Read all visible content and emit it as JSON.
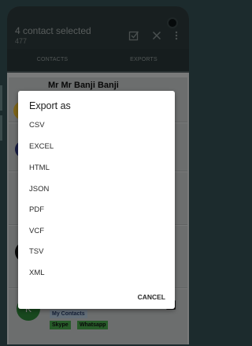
{
  "appbar": {
    "title": "4 contact selected",
    "subtitle": "477"
  },
  "tabs": [
    {
      "label": "CONTACTS"
    },
    {
      "label": "EXPORTS"
    }
  ],
  "contacts": {
    "first_name": "Mr Mr Banji Banji",
    "last_avatar_letter": "K",
    "group_tag": "My Contacts",
    "tags": [
      "Skype",
      "Whatsapp"
    ]
  },
  "dialog": {
    "title": "Export as",
    "options": [
      "CSV",
      "EXCEL",
      "HTML",
      "JSON",
      "PDF",
      "VCF",
      "TSV",
      "XML"
    ],
    "cancel_label": "CANCEL"
  },
  "colors": {
    "dialog_bg": "#ffffff",
    "appbar_bg": "#2f3d3e",
    "tag_green": "#4caf50",
    "tag_blue": "#bfd3e6",
    "avatar_green": "#2e8b3a",
    "avatar_yellow": "#f2c230",
    "avatar_navy": "#2b3580"
  }
}
